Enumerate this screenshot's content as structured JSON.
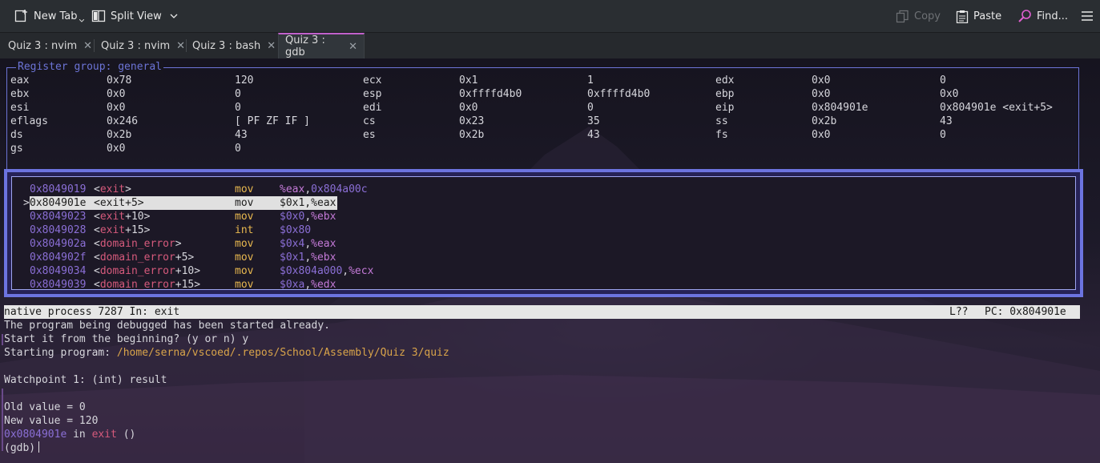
{
  "toolbar": {
    "new_tab": "New Tab",
    "split_view": "Split View",
    "copy": "Copy",
    "paste": "Paste",
    "find": "Find..."
  },
  "tabs": [
    {
      "label": "Quiz 3 : nvim",
      "active": false
    },
    {
      "label": "Quiz 3 : nvim",
      "active": false
    },
    {
      "label": "Quiz 3 : bash",
      "active": false
    },
    {
      "label": "Quiz 3 : gdb",
      "active": true
    }
  ],
  "registers": {
    "title": "Register group: general",
    "rows": [
      [
        [
          "eax",
          "0x78",
          "120"
        ],
        [
          "ecx",
          "0x1",
          "1"
        ],
        [
          "edx",
          "0x0",
          "0"
        ]
      ],
      [
        [
          "ebx",
          "0x0",
          "0"
        ],
        [
          "esp",
          "0xffffd4b0",
          "0xffffd4b0"
        ],
        [
          "ebp",
          "0x0",
          "0x0"
        ]
      ],
      [
        [
          "esi",
          "0x0",
          "0"
        ],
        [
          "edi",
          "0x0",
          "0"
        ],
        [
          "eip",
          "0x804901e",
          "0x804901e <exit+5>"
        ]
      ],
      [
        [
          "eflags",
          "0x246",
          "[ PF ZF IF ]"
        ],
        [
          "cs",
          "0x23",
          "35"
        ],
        [
          "ss",
          "0x2b",
          "43"
        ]
      ],
      [
        [
          "ds",
          "0x2b",
          "43"
        ],
        [
          "es",
          "0x2b",
          "43"
        ],
        [
          "fs",
          "0x0",
          "0"
        ]
      ],
      [
        [
          "gs",
          "0x0",
          "0"
        ]
      ]
    ]
  },
  "asm": [
    {
      "addr": "0x8049019",
      "sym": "exit",
      "off": "",
      "op": "mov",
      "args": [
        [
          "r",
          "%eax"
        ],
        [
          "p",
          ","
        ],
        [
          "n",
          "0x804a00c"
        ]
      ],
      "current": false
    },
    {
      "addr": "0x804901e",
      "sym": "exit",
      "off": "+5",
      "op": "mov",
      "args": [
        [
          "p",
          "$0x1,%eax"
        ]
      ],
      "current": true
    },
    {
      "addr": "0x8049023",
      "sym": "exit",
      "off": "+10",
      "op": "mov",
      "args": [
        [
          "n",
          "$0x0"
        ],
        [
          "p",
          ","
        ],
        [
          "r",
          "%ebx"
        ]
      ],
      "current": false
    },
    {
      "addr": "0x8049028",
      "sym": "exit",
      "off": "+15",
      "op": "int",
      "args": [
        [
          "n",
          "$0x80"
        ]
      ],
      "current": false
    },
    {
      "addr": "0x804902a",
      "sym": "domain_error",
      "off": "",
      "op": "mov",
      "args": [
        [
          "n",
          "$0x4"
        ],
        [
          "p",
          ","
        ],
        [
          "r",
          "%eax"
        ]
      ],
      "current": false
    },
    {
      "addr": "0x804902f",
      "sym": "domain_error",
      "off": "+5",
      "op": "mov",
      "args": [
        [
          "n",
          "$0x1"
        ],
        [
          "p",
          ","
        ],
        [
          "r",
          "%ebx"
        ]
      ],
      "current": false
    },
    {
      "addr": "0x8049034",
      "sym": "domain_error",
      "off": "+10",
      "op": "mov",
      "args": [
        [
          "n",
          "$0x804a000"
        ],
        [
          "p",
          ","
        ],
        [
          "r",
          "%ecx"
        ]
      ],
      "current": false
    },
    {
      "addr": "0x8049039",
      "sym": "domain_error",
      "off": "+15",
      "op": "mov",
      "args": [
        [
          "n",
          "$0xa"
        ],
        [
          "p",
          ","
        ],
        [
          "r",
          "%edx"
        ]
      ],
      "current": false
    }
  ],
  "status_bar": {
    "left": "native process 7287 In: exit",
    "line": "L??",
    "pc": "PC: 0x804901e"
  },
  "console": {
    "line1": "The program being debugged has been started already.",
    "line2": "Start it from the beginning? (y or n) y",
    "line3_prefix": "Starting program: ",
    "line3_path": "/home/serna/vscoed/.repos/School/Assembly/Quiz 3/quiz",
    "line5": "Watchpoint 1: (int) result",
    "line7": "Old value = 0",
    "line8": "New value = 120",
    "line9_addr": "0x0804901e",
    "line9_in": " in ",
    "line9_fn": "exit",
    "line9_tail": " ()",
    "prompt": "(gdb)"
  },
  "colors": {
    "accent": "#c061cb",
    "frame": "#6c74e0",
    "address": "#8b6fd6",
    "symbol": "#d65a7c",
    "opcode": "#e8b84f"
  }
}
